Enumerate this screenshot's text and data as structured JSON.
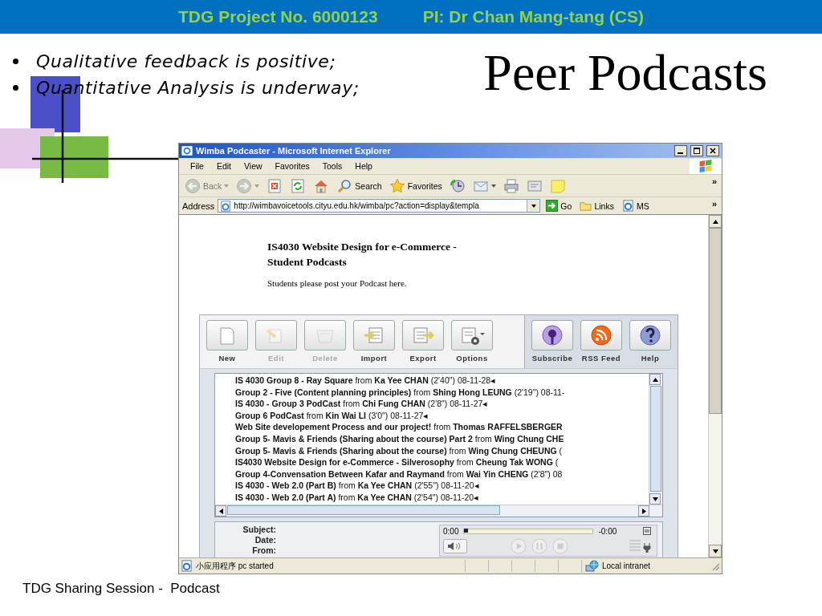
{
  "header": {
    "project": "TDG Project No. 6000123",
    "pi": "PI: Dr Chan Mang-tang (CS)"
  },
  "bullets": [
    "Qualitative feedback is positive;",
    "Quantitative Analysis is underway;"
  ],
  "title": "Peer Podcasts",
  "browser": {
    "title": "Wimba Podcaster - Microsoft Internet Explorer",
    "menu": [
      "File",
      "Edit",
      "View",
      "Favorites",
      "Tools",
      "Help"
    ],
    "toolbar": [
      {
        "kind": "back",
        "label": "Back",
        "disabled": true,
        "dropdown": true
      },
      {
        "kind": "forward",
        "disabled": true,
        "dropdown": true
      },
      {
        "kind": "stop",
        "disabled": false,
        "dropdown": false
      },
      {
        "kind": "refresh",
        "disabled": false,
        "dropdown": false
      },
      {
        "kind": "home",
        "disabled": false,
        "dropdown": false
      },
      {
        "kind": "search",
        "label": "Search",
        "disabled": false,
        "dropdown": false
      },
      {
        "kind": "favorites",
        "label": "Favorites",
        "disabled": false,
        "dropdown": false
      },
      {
        "kind": "history",
        "disabled": false,
        "dropdown": false
      },
      {
        "kind": "mail",
        "disabled": false,
        "dropdown": true
      },
      {
        "kind": "print",
        "disabled": false,
        "dropdown": false
      },
      {
        "kind": "edit",
        "disabled": false,
        "dropdown": false
      },
      {
        "kind": "note",
        "disabled": false,
        "dropdown": false
      }
    ],
    "toolbar_more": "»",
    "address": {
      "label": "Address",
      "url": "http://wimbavoicetools.cityu.edu.hk/wimba/pc?action=display&templa",
      "go": "Go",
      "links": "Links",
      "ms": "MS",
      "more": "»"
    },
    "page": {
      "heading": "IS4030 Website Design for e-Commerce - Student Podcasts",
      "intro": "Students please post your Podcast here.",
      "podcaster": {
        "tools": [
          {
            "kind": "new",
            "label": "New",
            "disabled": false
          },
          {
            "kind": "edit",
            "label": "Edit",
            "disabled": true
          },
          {
            "kind": "delete",
            "label": "Delete",
            "disabled": true
          },
          {
            "kind": "import",
            "label": "Import",
            "disabled": false
          },
          {
            "kind": "export",
            "label": "Export",
            "disabled": false
          },
          {
            "kind": "options",
            "label": "Options",
            "disabled": false
          }
        ],
        "feeds": [
          {
            "kind": "subscribe",
            "label": "Subscribe"
          },
          {
            "kind": "rss",
            "label": "RSS Feed"
          },
          {
            "kind": "help",
            "label": "Help"
          }
        ],
        "episodes": [
          "**IS 4030 Group 8 - Ray Square** from **Ka Yee CHAN** (2'40\") 08-11-28◂",
          "**Group 2 - Five (Content planning principles)** from **Shing Hong LEUNG** (2'19\") 08-11-",
          "**IS 4030 - Group 3 PodCast** from **Chi Fung CHAN** (2'8\") 08-11-27◂",
          "**Group 6 PodCast** from **Kin Wai LI** (3'0\") 08-11-27◂",
          "**Web Site developement Process and our project!** from **Thomas RAFFELSBERGER**",
          "**Group 5- Mavis & Friends (Sharing about the course) Part 2** from **Wing Chung CHE**",
          "**Group 5- Mavis & Friends (Sharing about the course)** from **Wing Chung CHEUNG** (",
          "**IS4030 Website Design for e-Commerce - Silverosophy** from **Cheung Tak WONG** (",
          "**Group 4-Convensation Between Kafar and Raymand** from **Wai Yin CHENG** (2'8\") 08",
          "**IS 4030 - Web 2.0 (Part B)** from **Ka Yee CHAN** (2'55\") 08-11-20◂",
          "**IS 4030 - Web 2.0 (Part A)** from **Ka Yee CHAN** (2'54\") 08-11-20◂"
        ],
        "details": [
          "Subject:",
          "Date:",
          "From:"
        ],
        "player": {
          "elapsed": "0:00",
          "remaining": "-0:00",
          "level": 0
        }
      }
    },
    "status_bar": {
      "text": "小应用程序 pc started",
      "zone": "Local intranet"
    }
  },
  "footer": "TDG Sharing Session -  Podcast"
}
